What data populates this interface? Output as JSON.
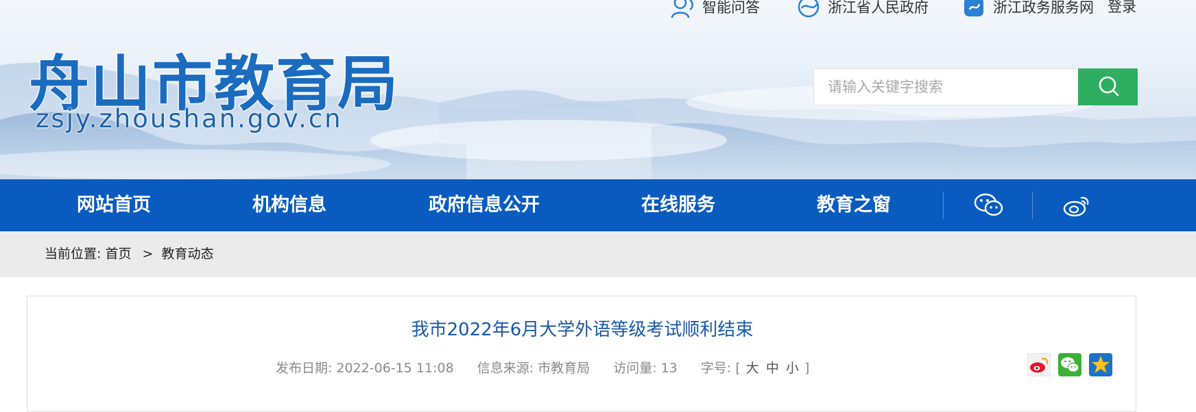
{
  "header": {
    "site_title": "舟山市教育局",
    "site_domain": "zsjy.zhoushan.gov.cn",
    "top_links": [
      {
        "label": "智能问答",
        "icon": "user-qa-icon"
      },
      {
        "label": "浙江省人民政府",
        "icon": "zhejiang-gov-icon"
      },
      {
        "label": "浙江政务服务网",
        "icon": "zhejiang-service-icon"
      },
      {
        "label": "登录"
      }
    ],
    "search": {
      "placeholder": "请输入关键字搜索",
      "value": "",
      "icon": "search-icon"
    }
  },
  "nav": {
    "items": [
      {
        "label": "网站首页"
      },
      {
        "label": "机构信息"
      },
      {
        "label": "政府信息公开"
      },
      {
        "label": "在线服务"
      },
      {
        "label": "教育之窗"
      }
    ],
    "icons": [
      "wechat-icon",
      "weibo-icon"
    ]
  },
  "breadcrumb": {
    "prefix": "当前位置:",
    "home": "首页",
    "separator": ">",
    "current": "教育动态"
  },
  "article": {
    "title": "我市2022年6月大学外语等级考试顺利结束",
    "publish_date": "发布日期: 2022-06-15 11:08",
    "source": "信息来源: 市教育局",
    "visits": "访问量: 13",
    "font_size_label": "字号: [",
    "font_sizes": [
      "大",
      "中",
      "小"
    ],
    "font_size_close": "]",
    "share_icons": [
      "weibo-share-icon",
      "wechat-share-icon",
      "qzone-share-icon"
    ]
  },
  "colors": {
    "nav_bg": "#0a5bbf",
    "search_button": "#2fae62",
    "title_blue": "#1a58a8",
    "logo_blue": "#1b6bbf"
  }
}
